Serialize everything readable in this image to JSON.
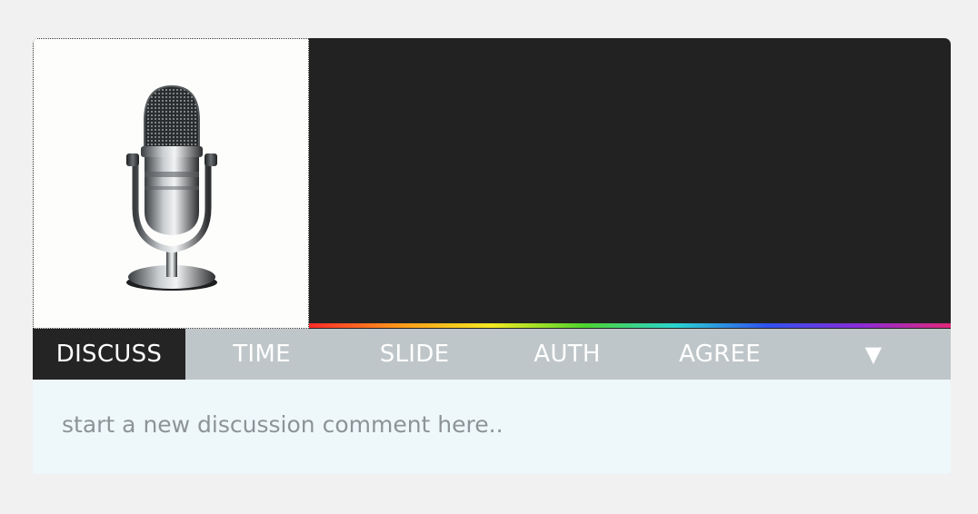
{
  "media": {
    "thumbnail_icon": "microphone-icon"
  },
  "tabs": [
    {
      "label": "DISCUSS",
      "active": true
    },
    {
      "label": "TIME",
      "active": false
    },
    {
      "label": "SLIDE",
      "active": false
    },
    {
      "label": "AUTH",
      "active": false
    },
    {
      "label": "AGREE",
      "active": false
    }
  ],
  "menu_toggle": {
    "label": "▼"
  },
  "comment": {
    "placeholder": "start a new discussion comment here..",
    "value": ""
  },
  "colors": {
    "page_bg": "#f1f1f1",
    "player_bg": "#222222",
    "tab_bar_bg": "#bfc6c9",
    "tab_active_bg": "#242424",
    "comment_bg": "#eef8fb"
  }
}
